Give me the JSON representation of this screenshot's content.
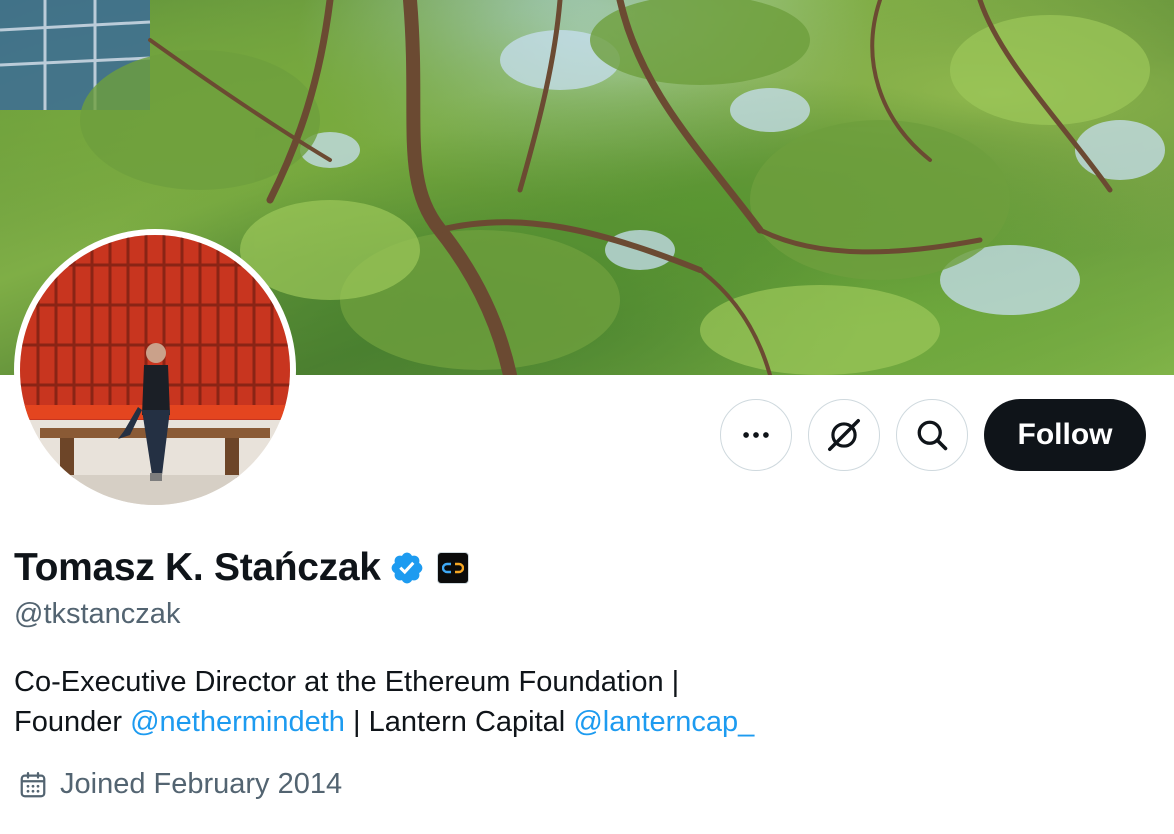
{
  "profile": {
    "display_name": "Tomasz K. Stańczak",
    "handle": "@tkstanczak",
    "bio": {
      "line1": "Co-Executive Director at the Ethereum Foundation |",
      "line2_prefix": "Founder ",
      "mention1": "@nethermindeth",
      "line2_middle": " | Lantern Capital ",
      "mention2": "@lanterncap_"
    },
    "joined": "Joined February 2014",
    "verified": true,
    "verified_color": "#1d9bf0"
  },
  "actions": {
    "more_icon": "more-horizontal-icon",
    "grok_icon": "grok-icon",
    "search_icon": "search-icon",
    "follow_label": "Follow"
  },
  "colors": {
    "text_primary": "#0f1419",
    "text_secondary": "#536471",
    "link": "#1d9bf0",
    "follow_bg": "#0f1419",
    "border": "#cfd9de"
  }
}
